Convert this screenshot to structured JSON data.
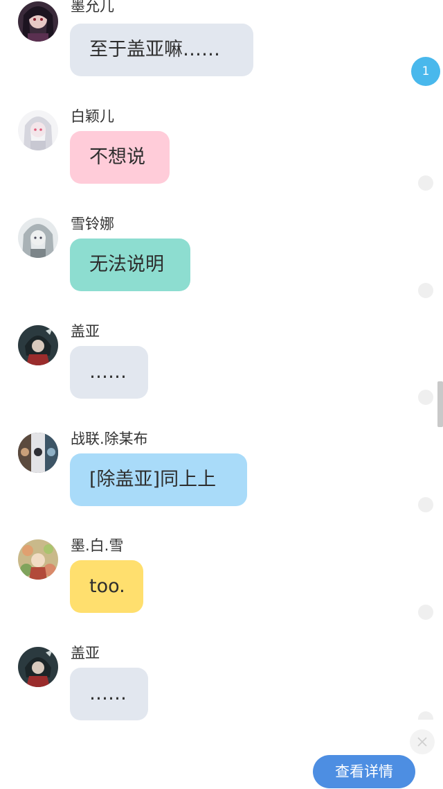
{
  "unread_badge": "1",
  "colors": {
    "bubble_gray": "#e2e7ef",
    "bubble_pink": "#ffccd9",
    "bubble_teal": "#8dddd0",
    "bubble_blue": "#a9dbf9",
    "bubble_yellow": "#ffdf6e",
    "accent_blue": "#4d8ee2",
    "badge_blue": "#49b8ec"
  },
  "messages": [
    {
      "sender": "墨允儿",
      "text": "至于盖亚嘛……",
      "bubble_color": "gray",
      "avatar": "dark-hair-girl-avatar"
    },
    {
      "sender": "白颖儿",
      "text": "不想说",
      "bubble_color": "pink",
      "avatar": "white-hair-girl-avatar"
    },
    {
      "sender": "雪铃娜",
      "text": "无法说明",
      "bubble_color": "teal",
      "avatar": "silver-hair-girl-avatar"
    },
    {
      "sender": "盖亚",
      "text": "……",
      "bubble_color": "gray",
      "avatar": "hooded-boy-avatar"
    },
    {
      "sender": "战联.除某布",
      "text": "[除盖亚]同上上",
      "bubble_color": "blue",
      "avatar": "collage-avatar"
    },
    {
      "sender": "墨.白.雪",
      "text": "too.",
      "bubble_color": "yellow",
      "avatar": "flower-girl-avatar"
    },
    {
      "sender": "盖亚",
      "text": "……",
      "bubble_color": "gray",
      "avatar": "hooded-boy-avatar"
    }
  ],
  "footer": {
    "detail_button_label": "查看详情",
    "close_icon": "close-icon"
  }
}
